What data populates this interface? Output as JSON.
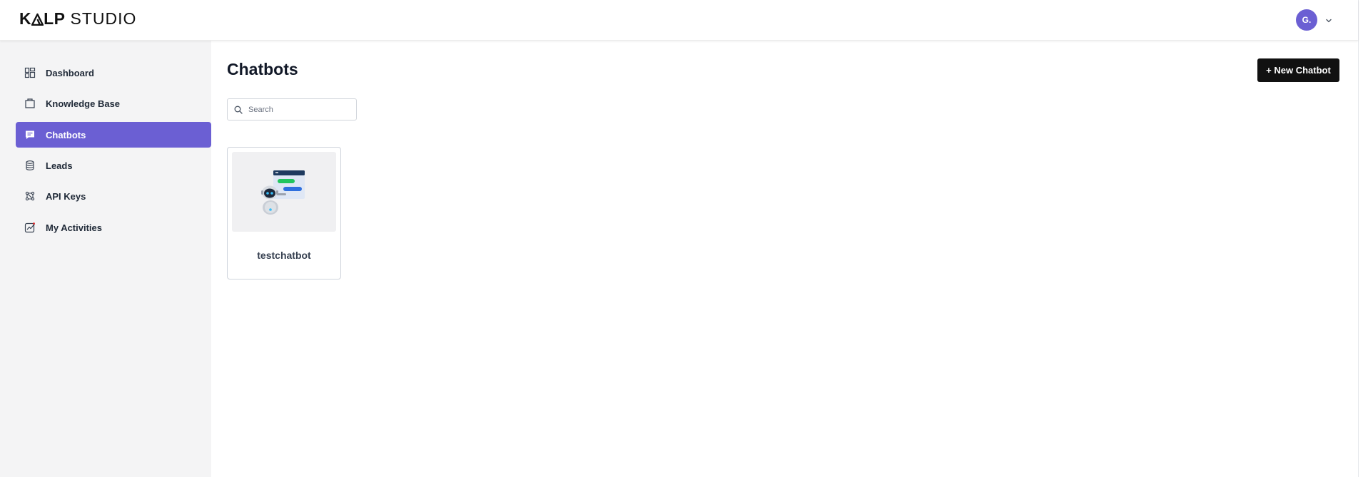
{
  "app": {
    "logo_text": "KɅLP STUDIO",
    "logo_part1": "K",
    "logo_part2": "LP",
    "logo_part3": "STUDIO",
    "brand_color": "#6b5fd3"
  },
  "user": {
    "avatar_initials": "G.",
    "avatar_color": "#6b5fd3"
  },
  "sidebar": {
    "items": [
      {
        "label": "Dashboard",
        "icon": "dashboard-icon",
        "active": false
      },
      {
        "label": "Knowledge Base",
        "icon": "knowledge-base-icon",
        "active": false
      },
      {
        "label": "Chatbots",
        "icon": "chat-bubble-icon",
        "active": true
      },
      {
        "label": "Leads",
        "icon": "database-icon",
        "active": false
      },
      {
        "label": "API Keys",
        "icon": "api-keys-icon",
        "active": false
      },
      {
        "label": "My Activities",
        "icon": "activity-chart-icon",
        "active": false
      }
    ]
  },
  "main": {
    "title": "Chatbots",
    "new_button_label": "+ New Chatbot",
    "search": {
      "placeholder": "Search",
      "value": ""
    },
    "chatbots": [
      {
        "name": "testchatbot",
        "thumbnail": "chatbot-illustration"
      }
    ]
  }
}
